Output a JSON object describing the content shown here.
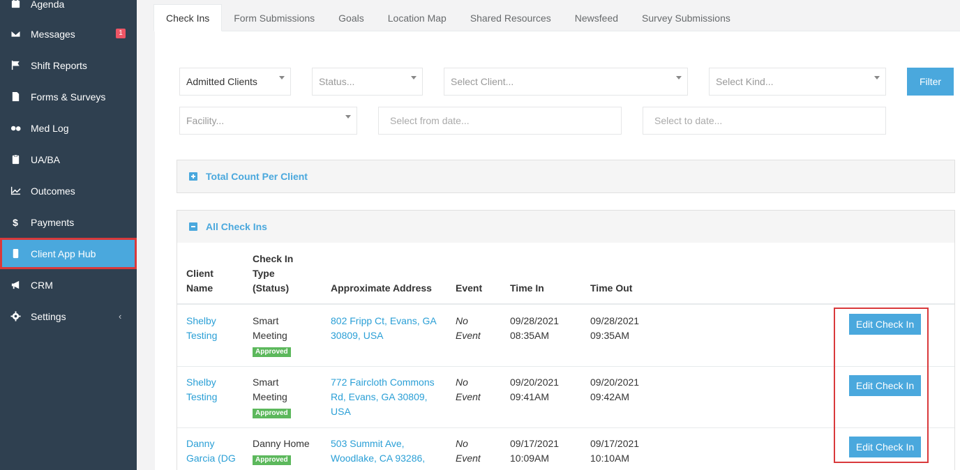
{
  "sidebar": {
    "items": [
      {
        "label": "Agenda",
        "icon": "calendar-icon"
      },
      {
        "label": "Messages",
        "icon": "envelope-icon",
        "badge": "1"
      },
      {
        "label": "Shift Reports",
        "icon": "flag-icon"
      },
      {
        "label": "Forms & Surveys",
        "icon": "file-icon"
      },
      {
        "label": "Med Log",
        "icon": "pills-icon"
      },
      {
        "label": "UA/BA",
        "icon": "clipboard-icon"
      },
      {
        "label": "Outcomes",
        "icon": "chart-line-icon"
      },
      {
        "label": "Payments",
        "icon": "dollar-icon"
      },
      {
        "label": "Client App Hub",
        "icon": "mobile-icon",
        "active": true
      },
      {
        "label": "CRM",
        "icon": "bullhorn-icon"
      },
      {
        "label": "Settings",
        "icon": "gear-icon",
        "chevron": "‹"
      }
    ]
  },
  "tabs": [
    "Check Ins",
    "Form Submissions",
    "Goals",
    "Location Map",
    "Shared Resources",
    "Newsfeed",
    "Survey Submissions"
  ],
  "filters": {
    "admitted": "Admitted Clients",
    "status_placeholder": "Status...",
    "client_placeholder": "Select Client...",
    "kind_placeholder": "Select Kind...",
    "filter_button": "Filter",
    "facility_placeholder": "Facility...",
    "from_date_placeholder": "Select from date...",
    "to_date_placeholder": "Select to date..."
  },
  "sections": {
    "total_count": "Total Count Per Client",
    "all_check_ins": "All Check Ins"
  },
  "table": {
    "headers": {
      "client_name_1": "Client",
      "client_name_2": "Name",
      "type_1": "Check In",
      "type_2": "Type",
      "type_3": "(Status)",
      "address": "Approximate Address",
      "event": "Event",
      "time_in": "Time In",
      "time_out": "Time Out"
    },
    "rows": [
      {
        "client_1": "Shelby",
        "client_2": "Testing",
        "type_1": "Smart",
        "type_2": "Meeting",
        "status": "Approved",
        "addr_1": "802 Fripp Ct, Evans, GA",
        "addr_2": "30809, USA",
        "addr_3": "",
        "event_1": "No",
        "event_2": "Event",
        "in_date": "09/28/2021",
        "in_time": "08:35AM",
        "out_date": "09/28/2021",
        "out_time": "09:35AM",
        "action": "Edit Check In"
      },
      {
        "client_1": "Shelby",
        "client_2": "Testing",
        "type_1": "Smart",
        "type_2": "Meeting",
        "status": "Approved",
        "addr_1": "772 Faircloth Commons",
        "addr_2": "Rd, Evans, GA 30809,",
        "addr_3": "USA",
        "event_1": "No",
        "event_2": "Event",
        "in_date": "09/20/2021",
        "in_time": "09:41AM",
        "out_date": "09/20/2021",
        "out_time": "09:42AM",
        "action": "Edit Check In"
      },
      {
        "client_1": "Danny",
        "client_2": "Garcia (DG",
        "type_1": "Danny Home",
        "type_2": "",
        "status": "Approved",
        "addr_1": "503 Summit Ave,",
        "addr_2": "Woodlake, CA 93286,",
        "addr_3": "",
        "event_1": "No",
        "event_2": "Event",
        "in_date": "09/17/2021",
        "in_time": "10:09AM",
        "out_date": "09/17/2021",
        "out_time": "10:10AM",
        "action": "Edit Check In"
      }
    ]
  },
  "colors": {
    "sidebar_bg": "#2f4050",
    "accent": "#4aa8dd",
    "highlight_border": "#d9393b",
    "approved": "#5cb85c"
  }
}
